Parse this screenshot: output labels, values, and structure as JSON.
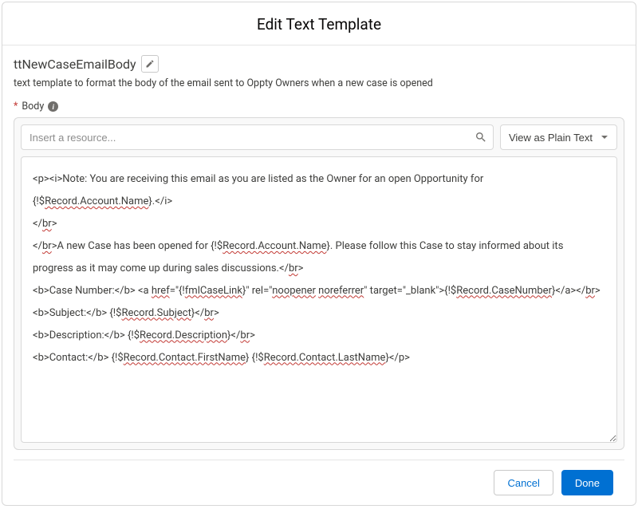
{
  "modal": {
    "title": "Edit Text Template"
  },
  "template": {
    "name": "ttNewCaseEmailBody",
    "description": "text template to format the body of the email sent to Oppty Owners when a new case is opened"
  },
  "field": {
    "required_indicator": "*",
    "label": "Body"
  },
  "toolbar": {
    "resource_placeholder": "Insert a resource...",
    "view_toggle_label": "View as Plain Text"
  },
  "body_content": {
    "l1a": "<p><i>Note: You are receiving this email as you are listed as the Owner for an open Opportunity for {!$",
    "l1b": "Record.Account.Name",
    "l1c": "}.</i>",
    "l2a": "</",
    "l2b": "br",
    "l2c": ">",
    "l3a": "</",
    "l3b": "br",
    "l3c": ">A new Case has been opened for {!$",
    "l3d": "Record.Account.Name",
    "l3e": "}. Please follow this Case to stay informed about its progress as it may come up during sales discussions.</",
    "l3f": "br",
    "l3g": ">",
    "l4a": "<b>Case Number:</b> <a ",
    "l4b": "href",
    "l4c": "=\"{!",
    "l4d": "fmlCaseLink",
    "l4e": "}\" rel=\"",
    "l4f": "noopener",
    "l4g": " ",
    "l4h": "noreferrer",
    "l4i": "\" target=\"_blank\">{!$",
    "l4j": "Record.CaseNumber",
    "l4k": "}</a></",
    "l4l": "br",
    "l4m": ">",
    "l5a": "<b>Subject:</b> {!$",
    "l5b": "Record.Subject",
    "l5c": "}</",
    "l5d": "br",
    "l5e": ">",
    "l6a": "<b>Description:</b> {!$",
    "l6b": "Record.Description",
    "l6c": "}</",
    "l6d": "br",
    "l6e": ">",
    "l7a": "<b>Contact:</b> {!$",
    "l7b": "Record.Contact.FirstName",
    "l7c": "} {!$",
    "l7d": "Record.Contact.LastName",
    "l7e": "}</p>"
  },
  "footer": {
    "cancel_label": "Cancel",
    "done_label": "Done"
  }
}
